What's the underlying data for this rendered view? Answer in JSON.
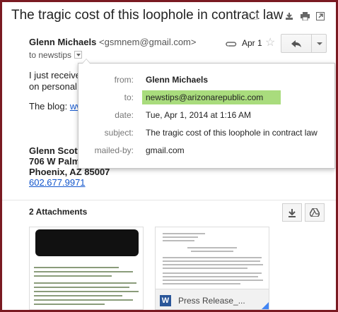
{
  "email": {
    "subject": "The tragic cost of this loophole in contract law",
    "sender_name": "Glenn Michaels",
    "sender_email": "<gsmnem@gmail.com>",
    "to_line": "to newstips",
    "date_short": "Apr 1",
    "body": {
      "line1": "I just receive",
      "line2": "on personal",
      "blog_label": "The blog: ",
      "blog_link": "ww",
      "sig_name": "Glenn Scott",
      "sig_address1": "706 W Palm",
      "sig_address2": "Phoenix, AZ  85007",
      "sig_phone": "602.677.9971"
    }
  },
  "details_popup": {
    "from_label": "from:",
    "from_value": "Glenn Michaels",
    "to_label": "to:",
    "to_value": "newstips@arizonarepublic.com",
    "date_label": "date:",
    "date_value": "Tue, Apr 1, 2014 at 1:16 AM",
    "subject_label": "subject:",
    "subject_value": "The tragic cost of this loophole in contract law",
    "mailedby_label": "mailed-by:",
    "mailedby_value": "gmail.com"
  },
  "attachments": {
    "title": "2 Attachments",
    "items": [
      {
        "name": "",
        "type": "image"
      },
      {
        "name": "Press Release_...",
        "type": "word-document"
      }
    ]
  },
  "colors": {
    "highlight": "#a9dc7d",
    "link": "#1155cc",
    "frame": "#7a1a22"
  }
}
